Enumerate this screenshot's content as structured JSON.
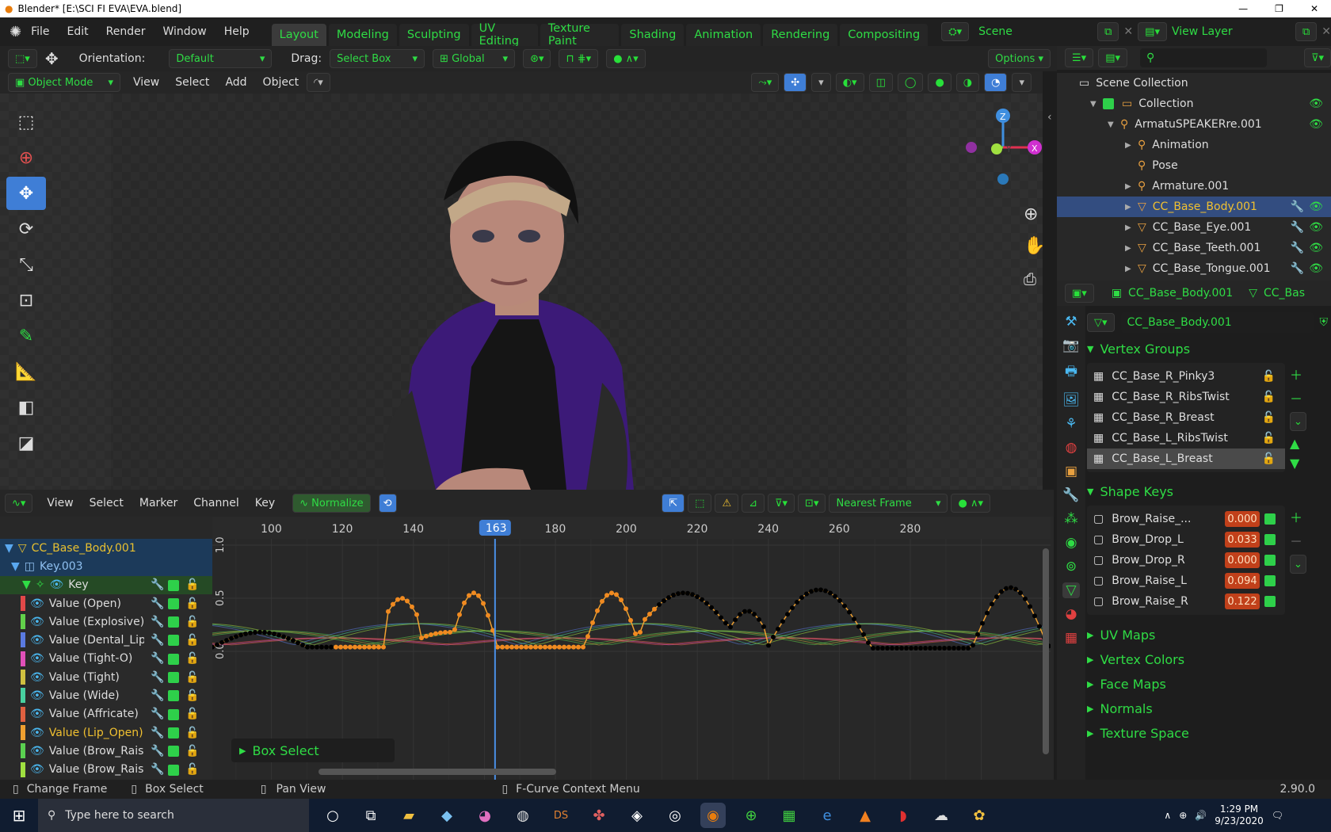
{
  "window": {
    "title": "Blender* [E:\\SCI FI EVA\\EVA.blend]",
    "min": "—",
    "max": "❐",
    "close": "✕"
  },
  "menu": [
    "File",
    "Edit",
    "Render",
    "Window",
    "Help"
  ],
  "workspaces": [
    "Layout",
    "Modeling",
    "Sculpting",
    "UV Editing",
    "Texture Paint",
    "Shading",
    "Animation",
    "Rendering",
    "Compositing"
  ],
  "scene": {
    "name": "Scene",
    "view_layer": "View Layer"
  },
  "header": {
    "orientation_label": "Orientation:",
    "orientation": "Default",
    "drag_label": "Drag:",
    "drag": "Select Box",
    "transform": "Global",
    "options": "Options"
  },
  "viewport_header": {
    "mode": "Object Mode",
    "items": [
      "View",
      "Select",
      "Add",
      "Object"
    ]
  },
  "gizmo": {
    "z": "Z",
    "x": "X",
    "y": "Y"
  },
  "graph_header": {
    "items": [
      "View",
      "Select",
      "Marker",
      "Channel",
      "Key"
    ],
    "normalize": "Normalize",
    "snap": "Nearest Frame"
  },
  "timeline": {
    "ticks": [
      "100",
      "120",
      "140",
      "1",
      "180",
      "200",
      "220",
      "240",
      "260",
      "280"
    ],
    "current": "163",
    "y_ticks": [
      "1.0",
      "0.5",
      "0.0"
    ]
  },
  "channels": {
    "object": "CC_Base_Body.001",
    "key": "Key.003",
    "group": "Key",
    "items": [
      {
        "label": "Value (Open)",
        "color": "#e24848"
      },
      {
        "label": "Value (Explosive)",
        "color": "#62d04a"
      },
      {
        "label": "Value (Dental_Lip)",
        "color": "#5a7ae0"
      },
      {
        "label": "Value (Tight-O)",
        "color": "#e050b8"
      },
      {
        "label": "Value (Tight)",
        "color": "#d0c040"
      },
      {
        "label": "Value (Wide)",
        "color": "#48d0a0"
      },
      {
        "label": "Value (Affricate)",
        "color": "#e06040"
      },
      {
        "label": "Value (Lip_Open)",
        "color": "#f0a030",
        "active": true
      },
      {
        "label": "Value (Brow_Raise_",
        "color": "#5ad050"
      },
      {
        "label": "Value (Brow_Raise_",
        "color": "#a0e040"
      }
    ]
  },
  "box_select_panel": "Box Select",
  "outliner": {
    "root": "Scene Collection",
    "items": [
      {
        "label": "Collection",
        "indent": 1
      },
      {
        "label": "ArmatuSPEAKERre.001",
        "indent": 2
      },
      {
        "label": "Animation",
        "indent": 3
      },
      {
        "label": "Pose",
        "indent": 3
      },
      {
        "label": "Armature.001",
        "indent": 3
      },
      {
        "label": "CC_Base_Body.001",
        "indent": 3,
        "selected": true
      },
      {
        "label": "CC_Base_Eye.001",
        "indent": 3
      },
      {
        "label": "CC_Base_Teeth.001",
        "indent": 3
      },
      {
        "label": "CC_Base_Tongue.001",
        "indent": 3
      }
    ]
  },
  "properties": {
    "object": "CC_Base_Body.001",
    "data_trunc": "CC_Bas",
    "mesh": "CC_Base_Body.001",
    "vertex_groups_title": "Vertex Groups",
    "vertex_groups": [
      "CC_Base_R_Pinky3",
      "CC_Base_R_RibsTwist",
      "CC_Base_R_Breast",
      "CC_Base_L_RibsTwist",
      "CC_Base_L_Breast"
    ],
    "shape_keys_title": "Shape Keys",
    "shape_keys": [
      {
        "name": "Brow_Raise_...",
        "value": "0.000"
      },
      {
        "name": "Brow_Drop_L",
        "value": "0.033"
      },
      {
        "name": "Brow_Drop_R",
        "value": "0.000"
      },
      {
        "name": "Brow_Raise_L",
        "value": "0.094"
      },
      {
        "name": "Brow_Raise_R",
        "value": "0.122"
      }
    ],
    "collapsed": [
      "UV Maps",
      "Vertex Colors",
      "Face Maps",
      "Normals",
      "Texture Space"
    ]
  },
  "status": {
    "left": "Change Frame",
    "mid1": "Box Select",
    "mid2": "Pan View",
    "ctx": "F-Curve Context Menu",
    "version": "2.90.0"
  },
  "taskbar": {
    "search": "Type here to search",
    "time": "1:29 PM",
    "date": "9/23/2020"
  }
}
